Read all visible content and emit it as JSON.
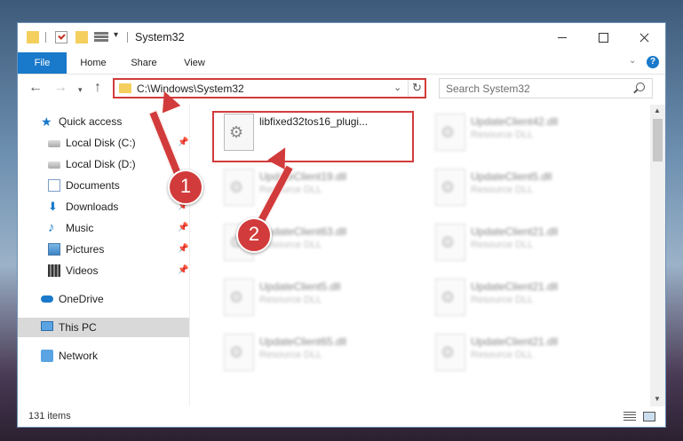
{
  "window": {
    "title": "System32",
    "close": "Close",
    "minimize": "Minimize",
    "maximize": "Maximize"
  },
  "ribbon": {
    "tabs": [
      "File",
      "Home",
      "Share",
      "View"
    ],
    "help": "?"
  },
  "navigation": {
    "address": "C:\\Windows\\System32",
    "search_placeholder": "Search System32"
  },
  "sidebar": {
    "items": [
      {
        "label": "Quick access",
        "icon": "star-icon"
      },
      {
        "label": "Local Disk (C:)",
        "icon": "drive-icon",
        "pinned": true
      },
      {
        "label": "Local Disk (D:)",
        "icon": "drive-icon"
      },
      {
        "label": "Documents",
        "icon": "documents-icon",
        "pinned": true
      },
      {
        "label": "Downloads",
        "icon": "download-icon",
        "pinned": true
      },
      {
        "label": "Music",
        "icon": "music-icon",
        "pinned": true
      },
      {
        "label": "Pictures",
        "icon": "pictures-icon",
        "pinned": true
      },
      {
        "label": "Videos",
        "icon": "videos-icon",
        "pinned": true
      },
      {
        "label": "OneDrive",
        "icon": "onedrive-icon"
      },
      {
        "label": "This PC",
        "icon": "pc-icon",
        "selected": true
      },
      {
        "label": "Network",
        "icon": "network-icon"
      }
    ]
  },
  "files": [
    {
      "name": "libfixed32tos16_plugi...",
      "type": "",
      "highlighted": true
    },
    {
      "name": "UpdateClient42.dll",
      "type": "Resource DLL"
    },
    {
      "name": "UpdateClient19.dll",
      "type": "Resource DLL"
    },
    {
      "name": "UpdateClient5.dll",
      "type": "Resource DLL"
    },
    {
      "name": "UpdateClient63.dll",
      "type": "Resource DLL"
    },
    {
      "name": "UpdateClient21.dll",
      "type": "Resource DLL"
    },
    {
      "name": "UpdateClient5.dll",
      "type": "Resource DLL"
    },
    {
      "name": "UpdateClient21.dll",
      "type": "Resource DLL"
    },
    {
      "name": "UpdateClient65.dll",
      "type": "Resource DLL"
    },
    {
      "name": "UpdateClient21.dll",
      "type": "Resource DLL"
    }
  ],
  "status": {
    "item_count": "131 items"
  },
  "annotations": {
    "step1": "1",
    "step2": "2",
    "color": "#d23b3b"
  }
}
